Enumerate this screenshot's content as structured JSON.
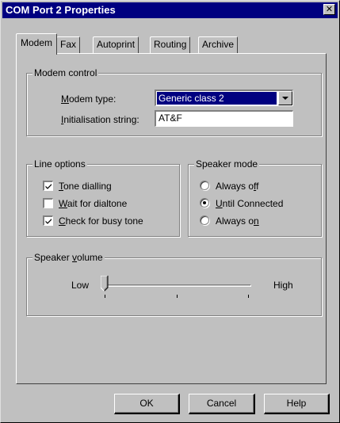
{
  "window": {
    "title": "COM Port 2 Properties",
    "close_glyph": "✕"
  },
  "tabs": [
    {
      "label": "Modem",
      "active": true
    },
    {
      "label": "Fax",
      "active": false
    },
    {
      "label": "Autoprint",
      "active": false
    },
    {
      "label": "Routing",
      "active": false
    },
    {
      "label": "Archive",
      "active": false
    }
  ],
  "modem_control": {
    "title": "Modem control",
    "type_label_pre": "",
    "type_label_u": "M",
    "type_label_post": "odem type:",
    "type_value": "Generic class 2",
    "init_label_u": "I",
    "init_label_post": "nitialisation string:",
    "init_value": "AT&F"
  },
  "line_options": {
    "title": "Line options",
    "items": [
      {
        "u": "T",
        "rest": "one dialling",
        "checked": true
      },
      {
        "u": "W",
        "rest": "ait for dialtone",
        "checked": false
      },
      {
        "u": "C",
        "rest": "heck for busy tone",
        "checked": true
      }
    ]
  },
  "speaker_mode": {
    "title": "Speaker mode",
    "options": [
      {
        "pre": "Always o",
        "u": "f",
        "post": "f",
        "selected": false
      },
      {
        "pre": "",
        "u": "U",
        "post": "ntil Connected",
        "selected": true
      },
      {
        "pre": "Always o",
        "u": "n",
        "post": "",
        "selected": false
      }
    ]
  },
  "speaker_volume": {
    "title_pre": "Speaker ",
    "title_u": "v",
    "title_post": "olume",
    "low_label": "Low",
    "high_label": "High",
    "level": 0
  },
  "buttons": {
    "ok": "OK",
    "cancel": "Cancel",
    "help": "Help"
  },
  "colors": {
    "face": "#c0c0c0",
    "title_bar": "#000080",
    "selection": "#000080"
  }
}
